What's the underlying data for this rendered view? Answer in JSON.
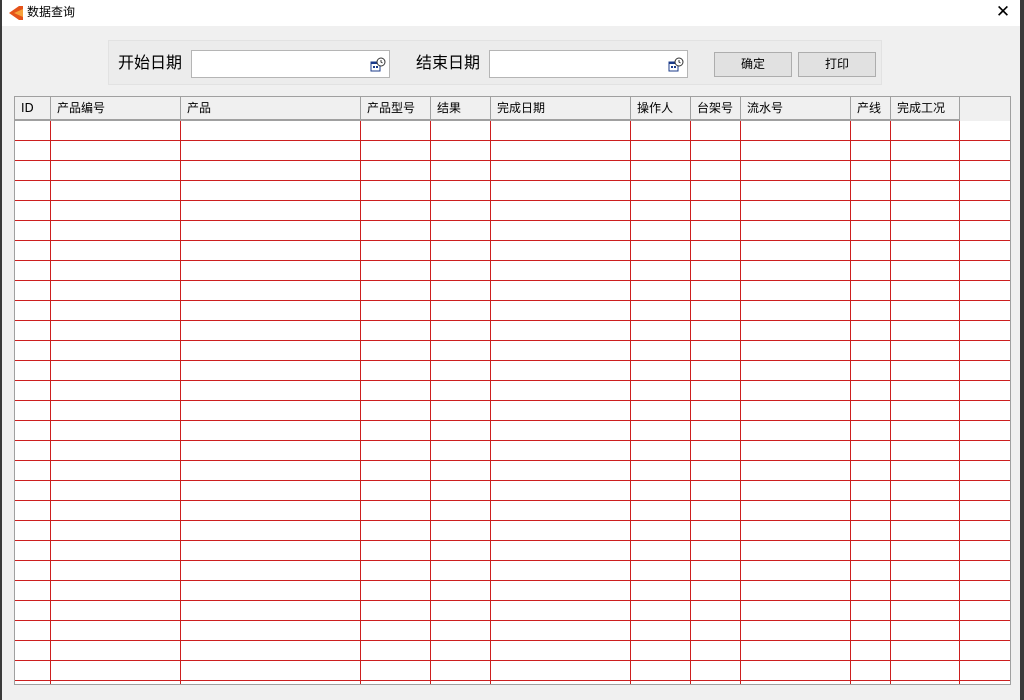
{
  "window": {
    "title": "数据查询",
    "close_glyph": "✕",
    "app_icon": "orange-chevron-app-icon",
    "close_icon": "close-icon"
  },
  "toolbar": {
    "start_date_label": "开始日期",
    "start_date_value": "",
    "end_date_label": "结束日期",
    "end_date_value": "",
    "calendar_icon": "calendar-clock-icon",
    "confirm_label": "确定",
    "print_label": "打印"
  },
  "table": {
    "columns": [
      "ID",
      "产品编号",
      "产品",
      "产品型号",
      "结果",
      "完成日期",
      "操作人",
      "台架号",
      "流水号",
      "产线",
      "完成工况"
    ],
    "rows": [],
    "grid_line_color": "#cc1f1f"
  }
}
